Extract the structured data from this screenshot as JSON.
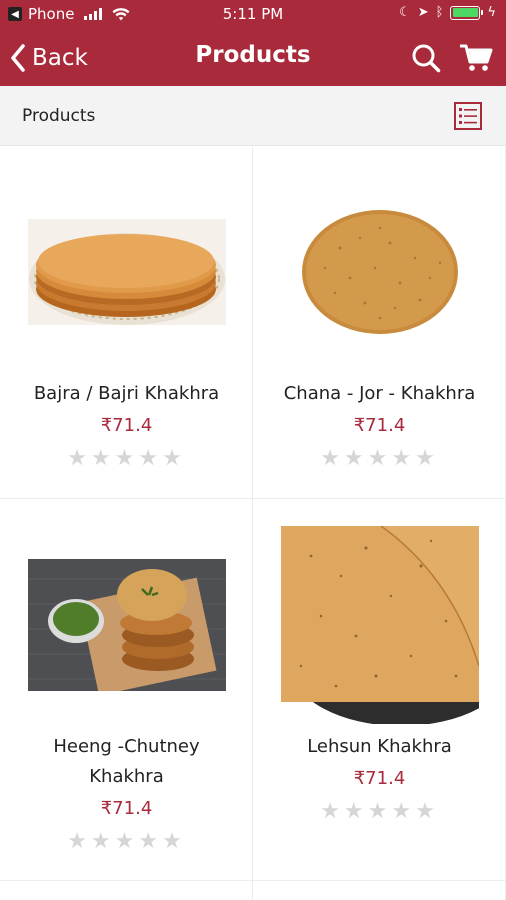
{
  "status_bar": {
    "carrier": "Phone",
    "time": "5:11 PM"
  },
  "nav": {
    "back_label": "Back",
    "title": "Products"
  },
  "subheader": {
    "title": "Products"
  },
  "products": [
    {
      "name": "Bajra / Bajri Khakhra",
      "price": "₹71.4",
      "rating": 0
    },
    {
      "name": "Chana - Jor - Khakhra",
      "price": "₹71.4",
      "rating": 0
    },
    {
      "name": "Heeng -Chutney Khakhra",
      "name_line1": "Heeng -Chutney",
      "name_line2": "Khakhra",
      "price": "₹71.4",
      "rating": 0
    },
    {
      "name": "Lehsun Khakhra",
      "price": "₹71.4",
      "rating": 0
    }
  ],
  "colors": {
    "brand": "#a92a3b",
    "star_empty": "#d6d6d6"
  }
}
